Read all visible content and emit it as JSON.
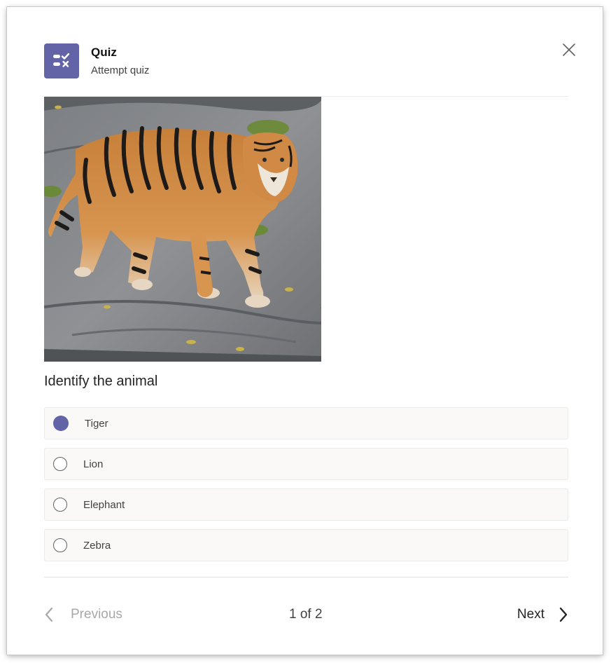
{
  "header": {
    "title": "Quiz",
    "subtitle": "Attempt quiz",
    "icon": "quiz-checklist-icon",
    "accent_color": "#6264a7"
  },
  "question": {
    "image_subject": "tiger-photo",
    "text": "Identify the animal"
  },
  "options": [
    {
      "label": "Tiger",
      "selected": true
    },
    {
      "label": "Lion",
      "selected": false
    },
    {
      "label": "Elephant",
      "selected": false
    },
    {
      "label": "Zebra",
      "selected": false
    }
  ],
  "footer": {
    "previous_label": "Previous",
    "previous_enabled": false,
    "page_indicator": "1 of 2",
    "next_label": "Next"
  }
}
